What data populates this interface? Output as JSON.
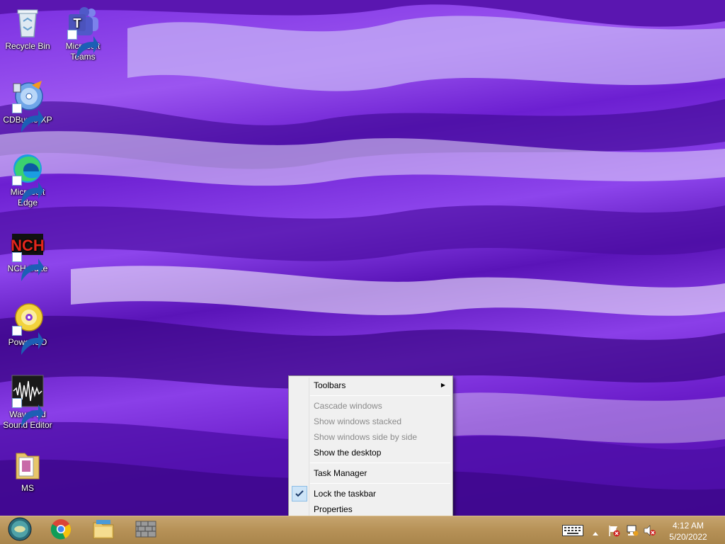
{
  "desktop": {
    "icons": [
      {
        "label": "Recycle Bin"
      },
      {
        "label": "Microsoft Teams"
      },
      {
        "label": "CDBurnerXP"
      },
      {
        "label": "Microsoft Edge"
      },
      {
        "label": "NCH Suite"
      },
      {
        "label": "PowerISO"
      },
      {
        "label": "WavePad Sound Editor"
      },
      {
        "label": "MS"
      }
    ]
  },
  "context_menu": {
    "toolbars": "Toolbars",
    "cascade_windows": "Cascade windows",
    "show_stacked": "Show windows stacked",
    "show_side_by_side": "Show windows side by side",
    "show_desktop": "Show the desktop",
    "task_manager": "Task Manager",
    "lock_taskbar": "Lock the taskbar",
    "properties": "Properties",
    "lock_taskbar_checked": true
  },
  "taskbar": {
    "pinned": [
      {
        "icon": "start-orb-icon"
      },
      {
        "icon": "chrome-icon"
      },
      {
        "icon": "file-explorer-icon"
      },
      {
        "icon": "firewall-icon"
      }
    ],
    "tray": {
      "icons": [
        "touch-keyboard-icon",
        "show-hidden-icons-icon",
        "action-center-flag-icon",
        "network-icon",
        "volume-muted-icon"
      ]
    },
    "clock": {
      "time": "4:12 AM",
      "date": "5/20/2022"
    }
  }
}
